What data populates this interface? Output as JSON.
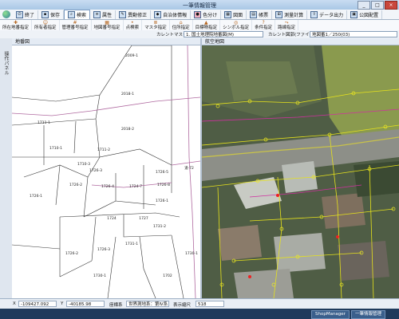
{
  "window": {
    "title": "一筆情報管理"
  },
  "menus": [
    {
      "label": "終了",
      "icon": "exit-icon"
    },
    {
      "label": "保存",
      "icon": "save-icon"
    },
    {
      "label": "検索",
      "icon": "search-icon"
    },
    {
      "label": "属性",
      "icon": "attribute-icon"
    },
    {
      "label": "異動修正",
      "icon": "edit-icon"
    },
    {
      "label": "自治体情報",
      "icon": "municipal-icon"
    },
    {
      "label": "色分け",
      "icon": "color-icon"
    },
    {
      "label": "図面",
      "icon": "drawing-icon"
    },
    {
      "label": "帳票",
      "icon": "report-icon"
    },
    {
      "label": "測量計算",
      "icon": "survey-icon"
    },
    {
      "label": "データ出力",
      "icon": "export-icon"
    },
    {
      "label": "公図配置",
      "icon": "layout-icon"
    }
  ],
  "tools": [
    {
      "label": "所在地番指定"
    },
    {
      "label": "所有者指定"
    },
    {
      "label": "管理番号指定"
    },
    {
      "label": "地図番号指定"
    },
    {
      "label": "点検索"
    },
    {
      "label": "マスタ指定"
    },
    {
      "label": "住所指定"
    },
    {
      "label": "目標物指定"
    },
    {
      "label": "シンボル指定"
    },
    {
      "label": "条件指定"
    },
    {
      "label": "路線指定"
    }
  ],
  "subbar": {
    "current_master_label": "カレントマスタ",
    "current_master_value": "1. 国土地理院地番図(M)",
    "current_layer_label": "カレント図郭(ファイル)",
    "current_layer_value": "地図番1／250(03)"
  },
  "side_panel": {
    "label": "操作パネル"
  },
  "left_panel": {
    "title": "地番図"
  },
  "right_panel": {
    "title": "航空地図"
  },
  "parcels": [
    "2009-1",
    "2018-1",
    "2018-2",
    "1711-1",
    "1710-1",
    "1710-3",
    "1711-2",
    "1726-3",
    "1726-2",
    "1726-4",
    "1726-1",
    "1726-5",
    "1724-7",
    "1726-8",
    "1724",
    "1727",
    "1731-2",
    "1726-1",
    "1731-1",
    "1726-2",
    "1726-3",
    "1730-1",
    "1730-1",
    "1702",
    "道-72"
  ],
  "status": {
    "x_label": "X",
    "x_value": "-109427.092",
    "y_label": "Y",
    "y_value": "-40185.98",
    "crs_label": "座標系",
    "crs_value": "世界測地系：第Ⅳ系",
    "scale_label": "表示縮尺",
    "scale_value": "518"
  },
  "taskbar": {
    "items": [
      "ShopManager",
      "一筆情報管理"
    ]
  }
}
